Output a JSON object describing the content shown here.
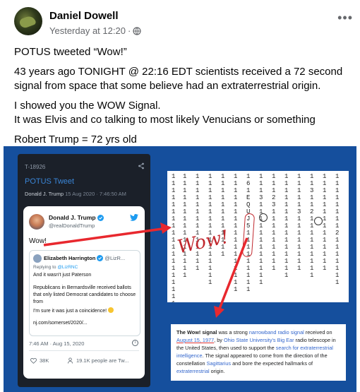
{
  "post": {
    "author": "Daniel Dowell",
    "timestamp": "Yesterday at 12:20",
    "separator": " · ",
    "more_label": "•••",
    "paragraphs": [
      "POTUS tweeted “Wow!”",
      "43 years ago TONIGHT @ 22:16 EDT scientists received a 72 second signal from space that some believe had an extraterrestrial origin.",
      "I showed you the WOW Signal.",
      "It was Elvis and co talking to most likely Venucians or something",
      "Robert Trump = 72 yrs old"
    ]
  },
  "phone_screenshot": {
    "id": "T-18926",
    "title": "POTUS Tweet",
    "subtitle_author": "Donald J. Trump",
    "subtitle_time": "15 Aug 2020 · 7:46:50 AM"
  },
  "tweet": {
    "name": "Donald J. Trump",
    "handle": "@realDonaldTrump",
    "text": "Wow!",
    "quote": {
      "name": "Elizabeth Harrington",
      "handle": "@LizR...",
      "replying_prefix": "Replying to ",
      "replying_to": "@LizRNC",
      "line1": "And it wasn't just Paterson",
      "line2": "Republicans in Bernardsville received ballots that only listed Democrat candidates to choose from",
      "line3": "I'm sure it was just a coincidence!",
      "line4": "nj.com/somerset/2020/..."
    },
    "time": "7:46 AM · Aug 15, 2020",
    "likes": "38K",
    "talking": "19.1K people are Tw..."
  },
  "wow_printout": {
    "annotation": "Wow!"
  },
  "wiki": {
    "title": "The Wow! signal",
    "t1": " was a strong ",
    "link1": "narrowband radio signal",
    "t2": " received on ",
    "date": "August 15, 1977",
    "t3": ", by ",
    "link2": "Ohio State University's",
    "t4": " ",
    "link3": "Big Ear",
    "t5": " radio telescope in the United States, then used to support the ",
    "link4": "search for extraterrestrial intelligence",
    "t6": ". The signal appeared to come from the direction of the constellation ",
    "link5": "Sagittarius",
    "t7": " and bore the expected hallmarks of ",
    "link6": "extraterrestrial",
    "t8": " origin."
  },
  "colors": {
    "media_bg": "#154f9d",
    "arrow": "#e8282e",
    "link_blue": "#3366cc",
    "twitter_blue": "#1d9bf0"
  }
}
